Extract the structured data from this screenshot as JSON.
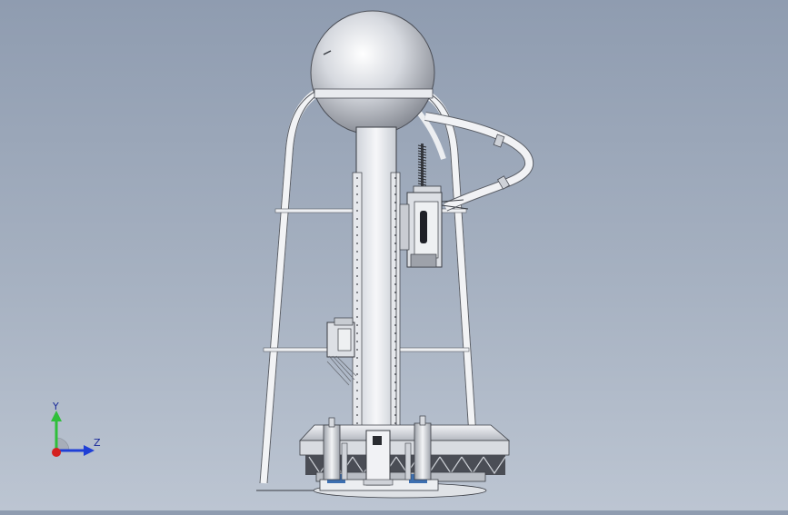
{
  "viewport": {
    "background_top": "#8f9cb0",
    "background_bottom": "#bcc5d2"
  },
  "triad": {
    "y_label": "Y",
    "z_label": "Z",
    "y_color": "#2fbf3a",
    "z_color": "#1f3fd6",
    "x_color": "#d42020"
  },
  "model": {
    "metal_color": "#e4e7ec",
    "edge_color": "#3a3d44",
    "dark_part_color": "#4a4d55"
  }
}
